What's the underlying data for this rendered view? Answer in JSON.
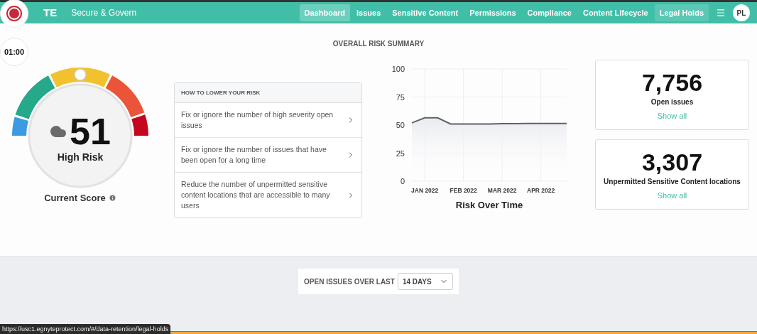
{
  "recorder": {
    "timer": "01:00"
  },
  "nav": {
    "logo": "TE",
    "product": "Secure & Govern",
    "items": [
      {
        "label": "Dashboard",
        "selected": true,
        "hovered": false
      },
      {
        "label": "Issues",
        "selected": false,
        "hovered": false
      },
      {
        "label": "Sensitive Content",
        "selected": false,
        "hovered": false
      },
      {
        "label": "Permissions",
        "selected": false,
        "hovered": false
      },
      {
        "label": "Compliance",
        "selected": false,
        "hovered": false
      },
      {
        "label": "Content Lifecycle",
        "selected": false,
        "hovered": false
      },
      {
        "label": "Legal Holds",
        "selected": false,
        "hovered": true
      }
    ],
    "avatar": "PL"
  },
  "summary": {
    "title": "OVERALL RISK SUMMARY",
    "score": {
      "value": "51",
      "label": "High Risk",
      "caption": "Current Score"
    },
    "tips": {
      "title": "HOW TO LOWER YOUR RISK",
      "items": [
        "Fix or ignore the number of high severity open issues",
        "Fix or ignore the number of issues that have been open for a long time",
        "Reduce the number of unpermitted sensitive content locations that are accessible to many users"
      ]
    },
    "chart": {
      "chart_data": {
        "type": "area",
        "title": "Risk Over Time",
        "categories": [
          null,
          "JAN 2022",
          null,
          null,
          "FEB 2022",
          null,
          null,
          "MAR 2022",
          null,
          null,
          "APR 2022",
          null,
          null
        ],
        "series": [
          {
            "color": "#5f6368",
            "values": [
              52,
              56.5,
              56.5,
              51,
              51,
              51,
              51,
              51.2,
              51.3,
              51.5,
              51.5,
              51.5,
              51.5
            ]
          }
        ],
        "ylim": [
          0,
          100
        ],
        "grid": true,
        "yticks": [
          0,
          25,
          50,
          75,
          100
        ]
      }
    },
    "stats": [
      {
        "value": "7,756",
        "label": "Open issues",
        "link": "Show all"
      },
      {
        "value": "3,307",
        "label": "Unpermitted Sensitive Content locations",
        "link": "Show all"
      }
    ]
  },
  "issues": {
    "label": "OPEN ISSUES OVER LAST",
    "range": "14 DAYS"
  },
  "status_url": "https://usc1.egnyteprotect.com/#/data-retention/legal-holds"
}
